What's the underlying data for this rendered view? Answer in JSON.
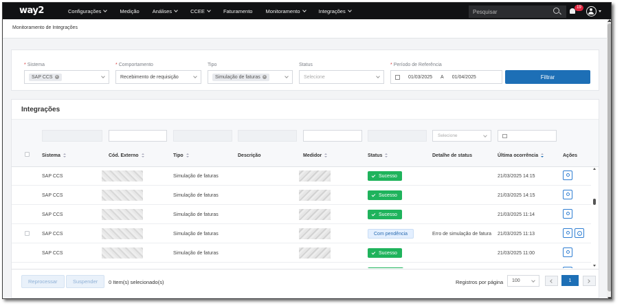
{
  "app": {
    "logo": "way2"
  },
  "nav": [
    {
      "label": "Configurações",
      "dropdown": true
    },
    {
      "label": "Medição",
      "dropdown": false
    },
    {
      "label": "Análises",
      "dropdown": true
    },
    {
      "label": "CCEE",
      "dropdown": true
    },
    {
      "label": "Faturamento",
      "dropdown": false
    },
    {
      "label": "Monitoramento",
      "dropdown": true
    },
    {
      "label": "Integrações",
      "dropdown": true
    }
  ],
  "header": {
    "search_placeholder": "Pesquisar",
    "notification_count": "19"
  },
  "breadcrumb": "Monitoramento de Integrações",
  "filters": {
    "sistema_label": "Sistema",
    "sistema_value": "SAP CCS",
    "comportamento_label": "Comportamento",
    "comportamento_value": "Recebimento de requisição",
    "tipo_label": "Tipo",
    "tipo_value": "Simulação de faturas",
    "status_label": "Status",
    "status_placeholder": "Selecione",
    "periodo_label": "Período de Referência",
    "date_from": "01/03/2025",
    "date_sep": "A",
    "date_to": "01/04/2025",
    "filter_button": "Filtrar"
  },
  "table": {
    "title": "Integrações",
    "status_filter_placeholder": "Selecione",
    "columns": {
      "sistema": "Sistema",
      "cod_externo": "Cód. Externo",
      "tipo": "Tipo",
      "descricao": "Descrição",
      "medidor": "Medidor",
      "status": "Status",
      "detalhe": "Detalhe de status",
      "ultima": "Última ocorrência",
      "acoes": "Ações"
    },
    "rows": [
      {
        "sistema": "SAP CCS",
        "tipo": "Simulação de faturas",
        "status": "Sucesso",
        "detalhe": "",
        "ultima": "21/03/2025 14:15",
        "kind": "ok"
      },
      {
        "sistema": "SAP CCS",
        "tipo": "Simulação de faturas",
        "status": "Sucesso",
        "detalhe": "",
        "ultima": "21/03/2025 14:15",
        "kind": "ok"
      },
      {
        "sistema": "SAP CCS",
        "tipo": "Simulação de faturas",
        "status": "Sucesso",
        "detalhe": "",
        "ultima": "21/03/2025 11:14",
        "kind": "ok"
      },
      {
        "sistema": "SAP CCS",
        "tipo": "Simulação de faturas",
        "status": "Com pendência",
        "detalhe": "Erro de simulação de fatura",
        "ultima": "21/03/2025 11:13",
        "kind": "pend"
      },
      {
        "sistema": "SAP CCS",
        "tipo": "Simulação de faturas",
        "status": "Sucesso",
        "detalhe": "",
        "ultima": "21/03/2025 11:00",
        "kind": "ok"
      }
    ]
  },
  "footer": {
    "reprocess_button": "Reprocessar",
    "suspend_button": "Suspender",
    "selected_count": "0 Item(s) selecionado(s)",
    "rows_per_page_label": "Registros por página",
    "rows_per_page_value": "100",
    "current_page": "1"
  }
}
